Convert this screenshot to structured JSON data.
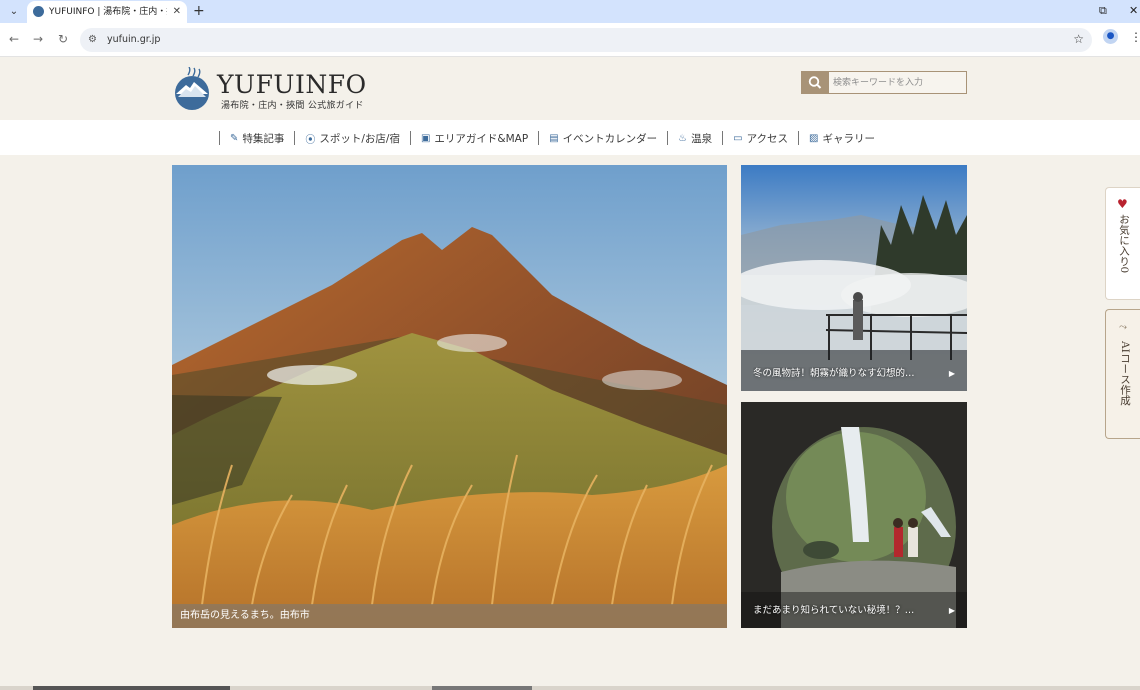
{
  "browser": {
    "tab_title": "YUFUINFO | 湯布院・庄内・挾間 公式旅ガイド",
    "url": "yufuin.gr.jp",
    "tab_close": "✕",
    "new_tab": "+",
    "minimize_glyph": "⧉",
    "close_glyph": "✕"
  },
  "header": {
    "logo_text": "YUFUINFO",
    "logo_sub": "湯布院・庄内・挾間 公式旅ガイド",
    "search_placeholder": "検索キーワードを入力"
  },
  "nav": {
    "items": [
      {
        "icon": "pencil-icon",
        "glyph": "✎",
        "label": "特集記事"
      },
      {
        "icon": "map-pin-icon",
        "glyph": "⦿",
        "label": "スポット/お店/宿"
      },
      {
        "icon": "map-icon",
        "glyph": "▣",
        "label": "エリアガイド&MAP"
      },
      {
        "icon": "calendar-icon",
        "glyph": "▤",
        "label": "イベントカレンダー"
      },
      {
        "icon": "onsen-icon",
        "glyph": "♨",
        "label": "温泉"
      },
      {
        "icon": "bus-icon",
        "glyph": "▭",
        "label": "アクセス"
      },
      {
        "icon": "image-icon",
        "glyph": "▨",
        "label": "ギャラリー"
      }
    ]
  },
  "hero": {
    "main_caption": "由布岳の見えるまち。由布市",
    "side_cards": [
      {
        "caption": "冬の風物詩！朝霧が織りなす幻想的…"
      },
      {
        "caption": "まだあまり知られていない秘境！？…"
      }
    ]
  },
  "floating": {
    "favorites_label": "お気に入り0",
    "ai_label": "AIコース作成"
  },
  "colors": {
    "page_bg": "#f4f1ea",
    "accent_brown": "#a89377",
    "logo_blue": "#3d6b9b",
    "heart_red": "#b9222f"
  }
}
